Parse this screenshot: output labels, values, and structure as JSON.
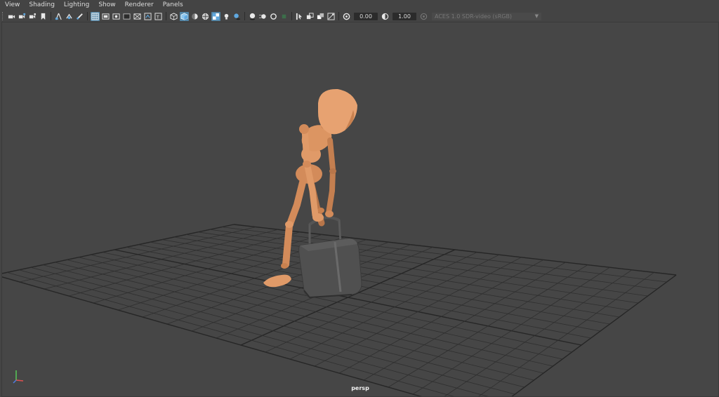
{
  "menu": {
    "items": [
      {
        "label": "View"
      },
      {
        "label": "Shading"
      },
      {
        "label": "Lighting"
      },
      {
        "label": "Show"
      },
      {
        "label": "Renderer"
      },
      {
        "label": "Panels"
      }
    ]
  },
  "toolbar": {
    "exposure_value": "0.00",
    "gamma_value": "1.00",
    "color_space": "ACES 1.0 SDR-video (sRGB)",
    "icons": [
      "select-camera-icon",
      "camera-attributes-icon",
      "bookmarks-icon",
      "bookmark-icon",
      "image-plane-icon",
      "2d-pan-zoom-icon",
      "grease-pencil-icon",
      "grid-icon",
      "film-gate-icon",
      "resolution-gate-icon",
      "gate-mask-icon",
      "field-chart-icon",
      "safe-action-icon",
      "safe-title-icon",
      "wireframe-icon",
      "smooth-shade-icon",
      "default-material-icon",
      "wireframe-on-shaded-icon",
      "textured-icon",
      "use-all-lights-icon",
      "shadows-icon",
      "screen-space-ao-icon",
      "motion-blur-icon",
      "anti-aliasing-icon",
      "depth-of-field-icon",
      "isolate-select-icon",
      "xray-icon",
      "xray-joints-icon",
      "xray-components-icon",
      "exposure-icon",
      "gamma-icon",
      "color-management-icon"
    ]
  },
  "viewport": {
    "camera_label": "persp",
    "background_color": "#464646",
    "grid_color": "#2f2f2f",
    "character_color": "#d98f5f",
    "suitcase_color": "#4f4f4f"
  }
}
